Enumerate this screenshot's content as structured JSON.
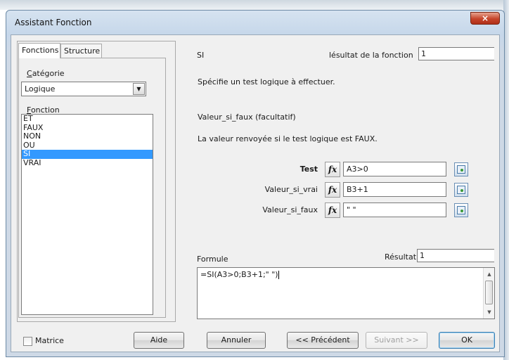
{
  "window": {
    "title": "Assistant Fonction",
    "close_glyph": "×"
  },
  "tabs": [
    {
      "label": "Fonctions"
    },
    {
      "label": "Structure"
    }
  ],
  "categorie": {
    "label": "Catégorie",
    "value": "Logique"
  },
  "fonction": {
    "label": "Fonction",
    "items": [
      "ET",
      "FAUX",
      "NON",
      "OU",
      "SI",
      "VRAI"
    ],
    "selected": "SI"
  },
  "panel": {
    "function_name": "SI",
    "result_label": "lésultat de la fonction",
    "result_value": "1",
    "description": "Spécifie un test logique à effectuer.",
    "arg_name": "Valeur_si_faux (facultatif)",
    "arg_description": "La valeur renvoyée si le test logique est FAUX."
  },
  "args": [
    {
      "label": "Test",
      "value": "A3>0",
      "bold": true
    },
    {
      "label": "Valeur_si_vrai",
      "value": "B3+1",
      "bold": false
    },
    {
      "label": "Valeur_si_faux",
      "value": "\" \"",
      "bold": false
    }
  ],
  "fx_glyph": "fx",
  "formule": {
    "label": "Formule",
    "value": "=SI(A3>0;B3+1;\" \")"
  },
  "resultat": {
    "label": "Résultat",
    "value": "1"
  },
  "matrice": {
    "label": "Matrice",
    "checked": false
  },
  "buttons": {
    "aide": "Aide",
    "annuler": "Annuler",
    "precedent": "<< Précédent",
    "suivant": "Suivant >>",
    "ok": "OK"
  }
}
